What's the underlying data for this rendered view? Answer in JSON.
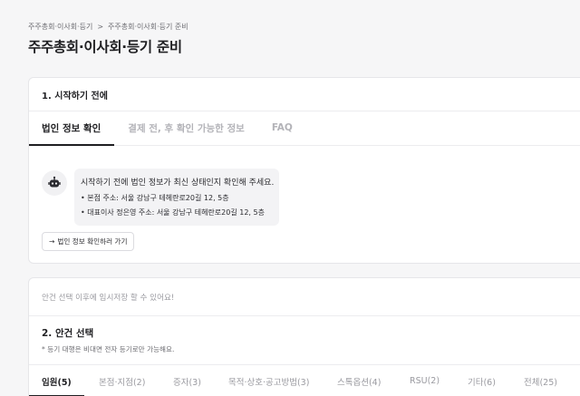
{
  "breadcrumb": {
    "items": [
      "주주총회·이사회·등기",
      "주주총회·이사회·등기 준비"
    ],
    "separator": ">"
  },
  "page_title": "주주총회·이사회·등기 준비",
  "section1": {
    "title": "1. 시작하기 전에",
    "tabs": [
      "법인 정보 확인",
      "결제 전, 후 확인 가능한 정보",
      "FAQ"
    ],
    "active_tab": 0,
    "notice": {
      "icon": "robot-icon",
      "message": "시작하기 전에 법인 정보가 최신 상태인지 확인해 주세요.",
      "items": [
        "• 본점 주소: 서울 강남구 테헤란로20길 12, 5층",
        "• 대표이사 정은영 주소: 서울 강남구 테헤란로20길 12, 5층"
      ]
    },
    "go_button": {
      "arrow": "→",
      "label": "법인 정보 확인하러 가기"
    }
  },
  "section2": {
    "temp_save_note": "안건 선택 이후에 임시저장 할 수 있어요!",
    "title": "2. 안건 선택",
    "subtitle": "* 등기 대행은 비대면 전자 등기로만 가능해요.",
    "tabs": [
      "임원(5)",
      "본점·지점(2)",
      "증자(3)",
      "목적·상호·공고방법(3)",
      "스톡옵션(4)",
      "RSU(2)",
      "기타(6)",
      "전체(25)"
    ],
    "active_tab": 0
  },
  "colors": {
    "background": "#f6f6f7",
    "card": "#ffffff",
    "text": "#1f1f22",
    "muted": "#9a9aa0"
  }
}
